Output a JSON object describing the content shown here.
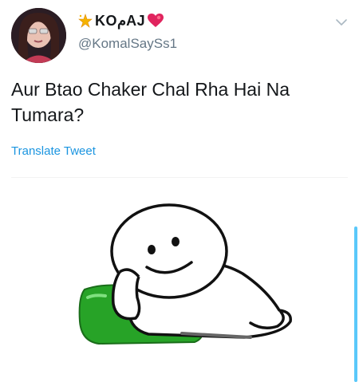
{
  "user": {
    "display_name": "KOمAJ",
    "handle": "@KomalSaySs1",
    "avatar_icon": "user-avatar-photo",
    "name_prefix_icon": "star-emoji-icon",
    "name_suffix_icon": "heart-emoji-icon"
  },
  "tweet": {
    "text": "Aur Btao Chaker Chal Rha Hai Na Tumara?",
    "translate_label": "Translate Tweet",
    "menu_icon": "chevron-down-icon"
  },
  "media": {
    "description_icon": "meme-lying-on-pillow-image"
  },
  "colors": {
    "link": "#1b95e0",
    "handle": "#657786",
    "text": "#14171a",
    "scrollbar": "#5ac8fa"
  }
}
